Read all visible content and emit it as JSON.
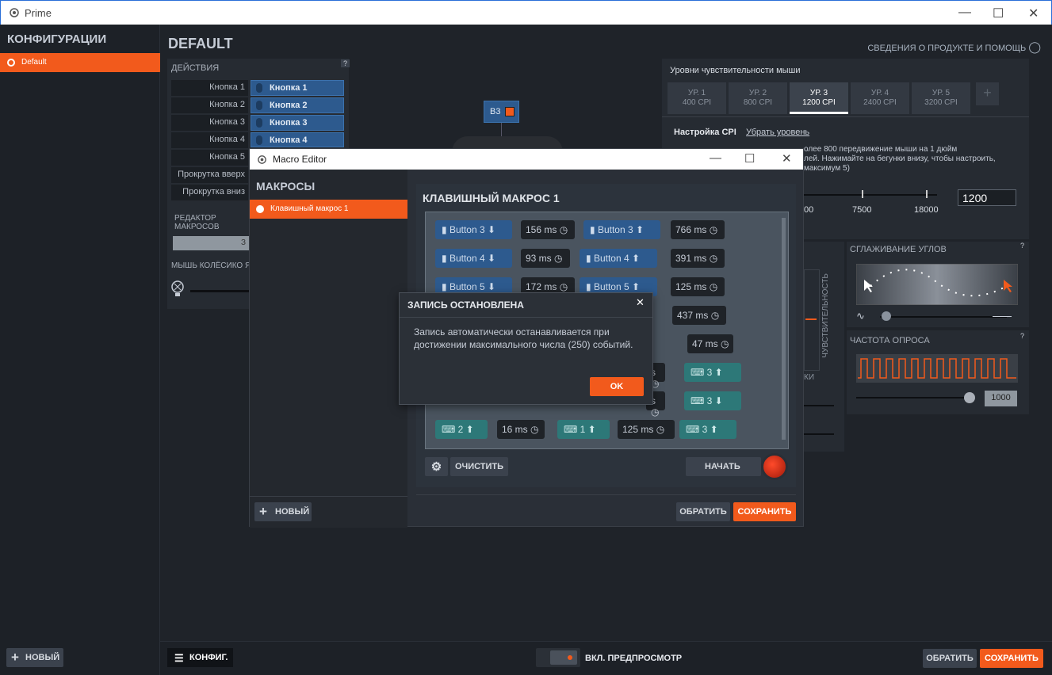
{
  "app": {
    "title": "Prime"
  },
  "sidebar": {
    "title": "КОНФИГУРАЦИИ",
    "configs": [
      {
        "label": "Default"
      }
    ],
    "new_label": "НОВЫЙ"
  },
  "main": {
    "title": "DEFAULT",
    "help_label": "СВЕДЕНИЯ О ПРОДУКТЕ И ПОМОЩЬ"
  },
  "actions": {
    "title": "ДЕЙСТВИЯ",
    "help": "?",
    "rows": [
      {
        "label": "Кнопка 1",
        "value": "Кнопка 1"
      },
      {
        "label": "Кнопка 2",
        "value": "Кнопка 2"
      },
      {
        "label": "Кнопка 3",
        "value": "Кнопка 3"
      },
      {
        "label": "Кнопка 4",
        "value": "Кнопка 4"
      },
      {
        "label": "Кнопка 5",
        "value": ""
      },
      {
        "label": "Прокрутка вверх",
        "value": ""
      },
      {
        "label": "Прокрутка вниз",
        "value": ""
      }
    ],
    "macro_editor_label": "РЕДАКТОР МАКРОСОВ",
    "macro_editor_btn": "З",
    "wheel_label": "МЫШЬ КОЛЁСИКО Я"
  },
  "mouse": {
    "badge": "B3"
  },
  "sensitivity": {
    "title": "Уровни чувствительности мыши",
    "levels": [
      {
        "name": "УР. 1",
        "cpi": "400 CPI"
      },
      {
        "name": "УР. 2",
        "cpi": "800 CPI"
      },
      {
        "name": "УР. 3",
        "cpi": "1200 CPI"
      },
      {
        "name": "УР. 4",
        "cpi": "2400 CPI"
      },
      {
        "name": "УР. 5",
        "cpi": "3200 CPI"
      }
    ],
    "add": "+",
    "setting_label": "Настройка CPI",
    "remove_label": "Убрать уровень",
    "desc_line1": "олее 800 передвижение мыши на 1 дюйм",
    "desc_line2": "лей. Нажимайте на бегунки внизу, чтобы настроить,",
    "desc_line3": "максимум 5)",
    "ticks": [
      "00",
      "7500",
      "18000"
    ],
    "value": "1200",
    "vertical_label": "ЧУВСТВИТЕЛЬНОСТЬ",
    "partial_label": "КИ"
  },
  "angle": {
    "title": "СГЛАЖИВАНИЕ УГЛОВ",
    "help": "?"
  },
  "polling": {
    "title": "ЧАСТОТА ОПРОСА",
    "help": "?",
    "value": "1000"
  },
  "bottom": {
    "config_label": "КОНФИГ.",
    "preview_label": "ВКЛ. ПРЕДПРОСМОТР",
    "revert": "ОБРАТИТЬ",
    "save": "СОХРАНИТЬ"
  },
  "macro_editor": {
    "title": "Macro Editor",
    "macros_title": "МАКРОСЫ",
    "macros": [
      {
        "label": "Клавишный макрос 1"
      }
    ],
    "new_label": "НОВЫЙ",
    "macro_title": "КЛАВИШНЫЙ МАКРОС 1",
    "clear": "ОЧИСТИТЬ",
    "start": "НАЧАТЬ",
    "revert": "ОБРАТИТЬ",
    "save": "СОХРАНИТЬ",
    "events": [
      {
        "k": "blue",
        "t": "Button 3",
        "dir": "down"
      },
      {
        "k": "time",
        "t": "156 ms"
      },
      {
        "k": "blue",
        "t": "Button 3",
        "dir": "up"
      },
      {
        "k": "time",
        "t": "766 ms"
      },
      {
        "k": "blue",
        "t": "Button 4",
        "dir": "down"
      },
      {
        "k": "time",
        "t": "93 ms"
      },
      {
        "k": "blue",
        "t": "Button 4",
        "dir": "up"
      },
      {
        "k": "time",
        "t": "391 ms"
      },
      {
        "k": "blue",
        "t": "Button 5",
        "dir": "down"
      },
      {
        "k": "time",
        "t": "172 ms"
      },
      {
        "k": "blue",
        "t": "Button 5",
        "dir": "up"
      },
      {
        "k": "time",
        "t": "125 ms"
      },
      {
        "k": "time",
        "t": "437 ms"
      },
      {
        "k": "time",
        "t": "47 ms"
      },
      {
        "k": "time",
        "t": "s"
      },
      {
        "k": "teal",
        "t": "3",
        "dir": "up"
      },
      {
        "k": "time",
        "t": "s"
      },
      {
        "k": "teal",
        "t": "3",
        "dir": "down"
      },
      {
        "k": "teal",
        "t": "2",
        "dir": "up"
      },
      {
        "k": "time",
        "t": "16 ms"
      },
      {
        "k": "teal",
        "t": "1",
        "dir": "up"
      },
      {
        "k": "time",
        "t": "125 ms"
      },
      {
        "k": "teal",
        "t": "3",
        "dir": "up"
      }
    ]
  },
  "dialog": {
    "title": "ЗАПИСЬ ОСТАНОВЛЕНА",
    "message": "Запись автоматически останавливается при достижении максимального числа (250) событий.",
    "ok": "OK"
  }
}
